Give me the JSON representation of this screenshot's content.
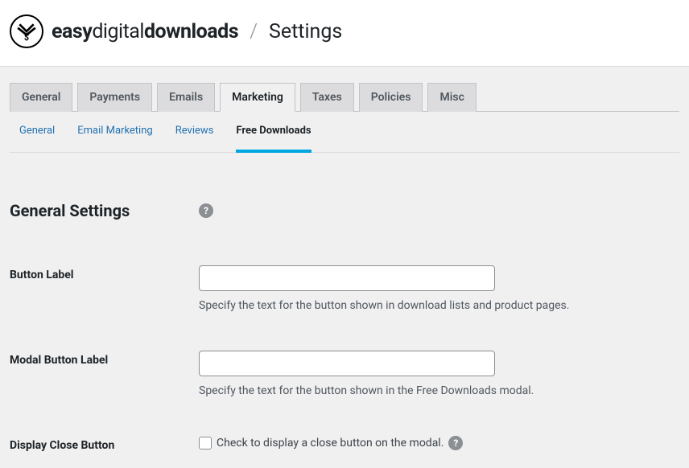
{
  "header": {
    "brand_bold1": "easy",
    "brand_light": "digital",
    "brand_bold2": "downloads",
    "separator": "/",
    "page_title": "Settings"
  },
  "tabs_primary": [
    {
      "label": "General"
    },
    {
      "label": "Payments"
    },
    {
      "label": "Emails"
    },
    {
      "label": "Marketing"
    },
    {
      "label": "Taxes"
    },
    {
      "label": "Policies"
    },
    {
      "label": "Misc"
    }
  ],
  "tabs_secondary": [
    {
      "label": "General"
    },
    {
      "label": "Email Marketing"
    },
    {
      "label": "Reviews"
    },
    {
      "label": "Free Downloads"
    }
  ],
  "form": {
    "section_title": "General Settings",
    "button_label": {
      "label": "Button Label",
      "value": "",
      "help": "Specify the text for the button shown in download lists and product pages."
    },
    "modal_button_label": {
      "label": "Modal Button Label",
      "value": "",
      "help": "Specify the text for the button shown in the Free Downloads modal."
    },
    "display_close": {
      "label": "Display Close Button",
      "checkbox_label": "Check to display a close button on the modal."
    }
  },
  "glyphs": {
    "help": "?"
  }
}
